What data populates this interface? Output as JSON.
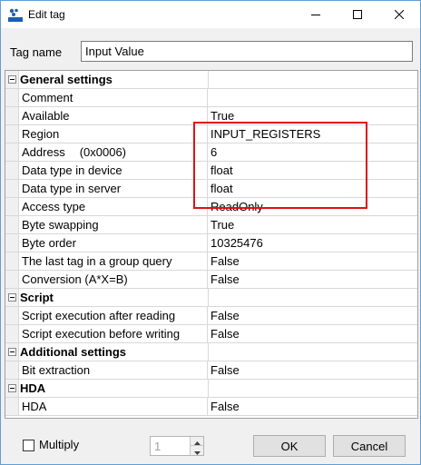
{
  "window": {
    "title": "Edit tag",
    "app_icon_text": "SOPC",
    "icons": {
      "minimize": "minimize-icon",
      "maximize": "maximize-icon",
      "close": "close-icon"
    }
  },
  "tag_name": {
    "label": "Tag name",
    "value": "Input Value"
  },
  "grid": {
    "general": {
      "header": "General settings",
      "rows": {
        "comment": {
          "name": "Comment",
          "value": ""
        },
        "available": {
          "name": "Available",
          "value": "True"
        },
        "region": {
          "name": "Region",
          "value": "INPUT_REGISTERS"
        },
        "address": {
          "name": "Address",
          "hex": "(0x0006)",
          "value": "6"
        },
        "dtype_device": {
          "name": "Data type in device",
          "value": "float"
        },
        "dtype_server": {
          "name": "Data type in server",
          "value": "float"
        },
        "access": {
          "name": "Access type",
          "value": "ReadOnly"
        },
        "byteswap": {
          "name": "Byte swapping",
          "value": "True"
        },
        "byteorder": {
          "name": "Byte order",
          "value": "10325476"
        },
        "lasttag": {
          "name": "The last tag in a group query",
          "value": "False"
        },
        "conversion": {
          "name": "Conversion (A*X=B)",
          "value": "False"
        }
      }
    },
    "script": {
      "header": "Script",
      "rows": {
        "after_reading": {
          "name": "Script execution after reading",
          "value": "False"
        },
        "before_writing": {
          "name": "Script execution before writing",
          "value": "False"
        }
      }
    },
    "additional": {
      "header": "Additional settings",
      "rows": {
        "bit_extraction": {
          "name": "Bit extraction",
          "value": "False"
        }
      }
    },
    "hda": {
      "header": "HDA",
      "rows": {
        "hda": {
          "name": "HDA",
          "value": "False"
        }
      }
    }
  },
  "annotation": {
    "color": "#e01010"
  },
  "footer": {
    "multiply_label": "Multiply",
    "multiply_checked": false,
    "spin_value": "1",
    "ok_label": "OK",
    "cancel_label": "Cancel"
  }
}
